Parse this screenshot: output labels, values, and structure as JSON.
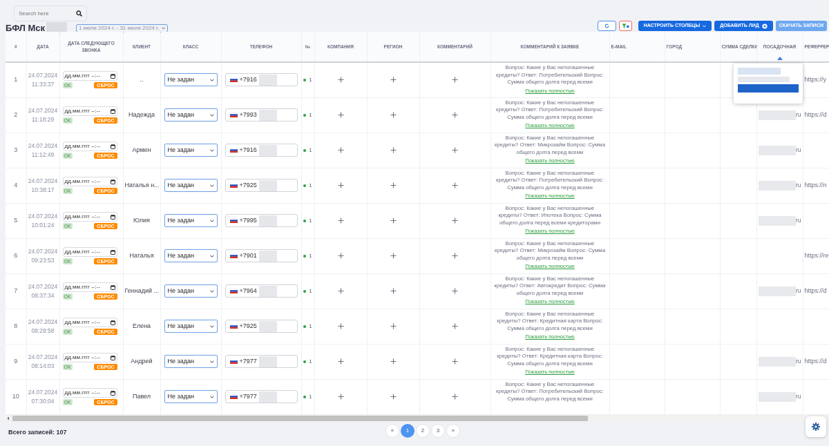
{
  "search": {
    "placeholder": "Search here"
  },
  "title": "БФЛ Мск",
  "date_range": "1 июля 2024 г. - 31 июля 2024 г.",
  "toolbar": {
    "columns_button": "НАСТРОИТЬ СТОЛБЦЫ",
    "add_button": "ДОБАВИТЬ ЛИД",
    "download_button": "СКАЧАТЬ ЗАПИСИ"
  },
  "columns": [
    {
      "label": "#",
      "sorted": false
    },
    {
      "label": "ДАТА",
      "sorted": false
    },
    {
      "label": "ДАТА СЛЕДУЮЩЕГО ЗВОНКА",
      "sorted": false
    },
    {
      "label": "КЛИЕНТ",
      "sorted": false
    },
    {
      "label": "КЛАСС",
      "sorted": false
    },
    {
      "label": "ТЕЛЕФОН",
      "sorted": false
    },
    {
      "label": "№",
      "sorted": false
    },
    {
      "label": "КОМПАНИЯ",
      "sorted": false
    },
    {
      "label": "РЕГИОН",
      "sorted": false
    },
    {
      "label": "КОММЕНТАРИЙ",
      "sorted": false
    },
    {
      "label": "КОММЕНТАРИЙ К ЗАЯВКЕ",
      "sorted": false
    },
    {
      "label": "E-MAIL",
      "sorted": false
    },
    {
      "label": "ГОРОД",
      "sorted": false
    },
    {
      "label": "СУММА СДЕЛКИ",
      "sorted": false
    },
    {
      "label": "ПОСАДОЧНАЯ",
      "sorted": true
    },
    {
      "label": "РЕФЕРРЕР",
      "sorted": false
    }
  ],
  "rows": [
    {
      "n": "1",
      "date": "24.07.2024",
      "time": "11:33:37",
      "next_call": {
        "placeholder": "дд.мм.гггг --:--",
        "ok": "OK",
        "reset": "СБРОС"
      },
      "client": "..",
      "class": "Не задан",
      "phone": "+7916",
      "num": "1",
      "comment": "Вопрос: Какие у Вас непогашенные кредиты? Ответ: Потребительский Вопрос: Сумма общего долга перед всеми",
      "more": "Показать полностью",
      "referrer": "https://y"
    },
    {
      "n": "2",
      "date": "24.07.2024",
      "time": "11:18:29",
      "next_call": {
        "placeholder": "дд.мм.гггг --:--",
        "ok": "OK",
        "reset": "СБРОС"
      },
      "client": "Надежда",
      "class": "Не задан",
      "phone": "+7993",
      "num": "1",
      "comment": "Вопрос: Какие у Вас непогашенные кредиты? Ответ: Потребительский Вопрос: Сумма общего долга перед всеми",
      "more": "Показать полностью",
      "landing": "ru",
      "referrer": "https://d"
    },
    {
      "n": "3",
      "date": "24.07.2024",
      "time": "11:12:49",
      "next_call": {
        "placeholder": "дд.мм.гггг --:--",
        "ok": "OK",
        "reset": "СБРОС"
      },
      "client": "Армен",
      "class": "Не задан",
      "phone": "+7916",
      "num": "1",
      "comment": "Вопрос: Какие у Вас непогашенные кредиты? Ответ: Микрозайм Вопрос: Сумма общего долга перед всеми",
      "more": "Показать полностью",
      "landing": "ru"
    },
    {
      "n": "4",
      "date": "24.07.2024",
      "time": "10:38:17",
      "next_call": {
        "placeholder": "дд.мм.гггг --:--",
        "ok": "OK",
        "reset": "СБРОС"
      },
      "client": "Наталья н...",
      "class": "Не задан",
      "phone": "+7925",
      "num": "1",
      "comment": "Вопрос: Какие у Вас непогашенные кредиты? Ответ: Потребительский Вопрос: Сумма общего долга перед всеми",
      "more": "Показать полностью",
      "landing": "ru",
      "referrer": "https://n"
    },
    {
      "n": "5",
      "date": "24.07.2024",
      "time": "10:01:24",
      "next_call": {
        "placeholder": "дд.мм.гггг --:--",
        "ok": "OK",
        "reset": "СБРОС"
      },
      "client": "Юлия",
      "class": "Не задан",
      "phone": "+7995",
      "num": "1",
      "comment": "Вопрос: Какие у Вас непогашенные кредиты? Ответ: Ипотека Вопрос: Сумма общего долга перед всеми кредиторами",
      "more": "Показать полностью",
      "landing": "ru"
    },
    {
      "n": "6",
      "date": "24.07.2024",
      "time": "09:23:53",
      "next_call": {
        "placeholder": "дд.мм.гггг --:--",
        "ok": "OK",
        "reset": "СБРОС"
      },
      "client": "Наталья",
      "class": "Не задан",
      "phone": "+7901",
      "num": "1",
      "comment": "Вопрос: Какие у Вас непогашенные кредиты? Ответ: Микрозайм Вопрос: Сумма общего долга перед всеми",
      "more": "Показать полностью",
      "referrer": "https://re"
    },
    {
      "n": "7",
      "date": "24.07.2024",
      "time": "08:37:34",
      "next_call": {
        "placeholder": "дд.мм.гггг --:--",
        "ok": "OK",
        "reset": "СБРОС"
      },
      "client": "Геннадий ...",
      "class": "Не задан",
      "phone": "+7964",
      "num": "1",
      "comment": "Вопрос: Какие у Вас непогашенные кредиты? Ответ: Автокредит Вопрос: Сумма общего долга перед всеми",
      "more": "Показать полностью",
      "landing": "ru",
      "referrer": "https://d"
    },
    {
      "n": "8",
      "date": "24.07.2024",
      "time": "08:29:58",
      "next_call": {
        "placeholder": "дд.мм.гггг --:--",
        "ok": "OK",
        "reset": "СБРОС"
      },
      "client": "Елена",
      "class": "Не задан",
      "phone": "+7925",
      "num": "1",
      "comment": "Вопрос: Какие у Вас непогашенные кредиты? Ответ: Кредитная карта Вопрос: Сумма общего долга перед всеми",
      "more": "Показать полностью"
    },
    {
      "n": "9",
      "date": "24.07.2024",
      "time": "08:14:03",
      "next_call": {
        "placeholder": "дд.мм.гггг --:--",
        "ok": "OK",
        "reset": "СБРОС"
      },
      "client": "Андрей",
      "class": "Не задан",
      "phone": "+7977",
      "num": "1",
      "comment": "Вопрос: Какие у Вас непогашенные кредиты? Ответ: Кредитная карта Вопрос: Сумма общего долга перед всеми",
      "more": "Показать полностью",
      "landing": "ru",
      "referrer": "https://d"
    },
    {
      "n": "10",
      "date": "24.07.2024",
      "time": "07:30:04",
      "next_call": {
        "placeholder": "дд.мм.гггг --:--",
        "ok": "OK",
        "reset": "СБРОС"
      },
      "client": "Павел",
      "class": "Не задан",
      "phone": "+7977",
      "num": "1",
      "comment": "Вопрос: Какие у Вас непогашенные кредиты? Ответ: Потребительский Вопрос: Сумма общего долга перед всеми",
      "landing": "ru"
    }
  ],
  "total": "Всего записей: 107",
  "pagination": [
    {
      "label": "«",
      "selected": false
    },
    {
      "label": "1",
      "selected": true
    },
    {
      "label": "2",
      "selected": false
    },
    {
      "label": "3",
      "selected": false
    },
    {
      "label": "»",
      "selected": false
    }
  ]
}
